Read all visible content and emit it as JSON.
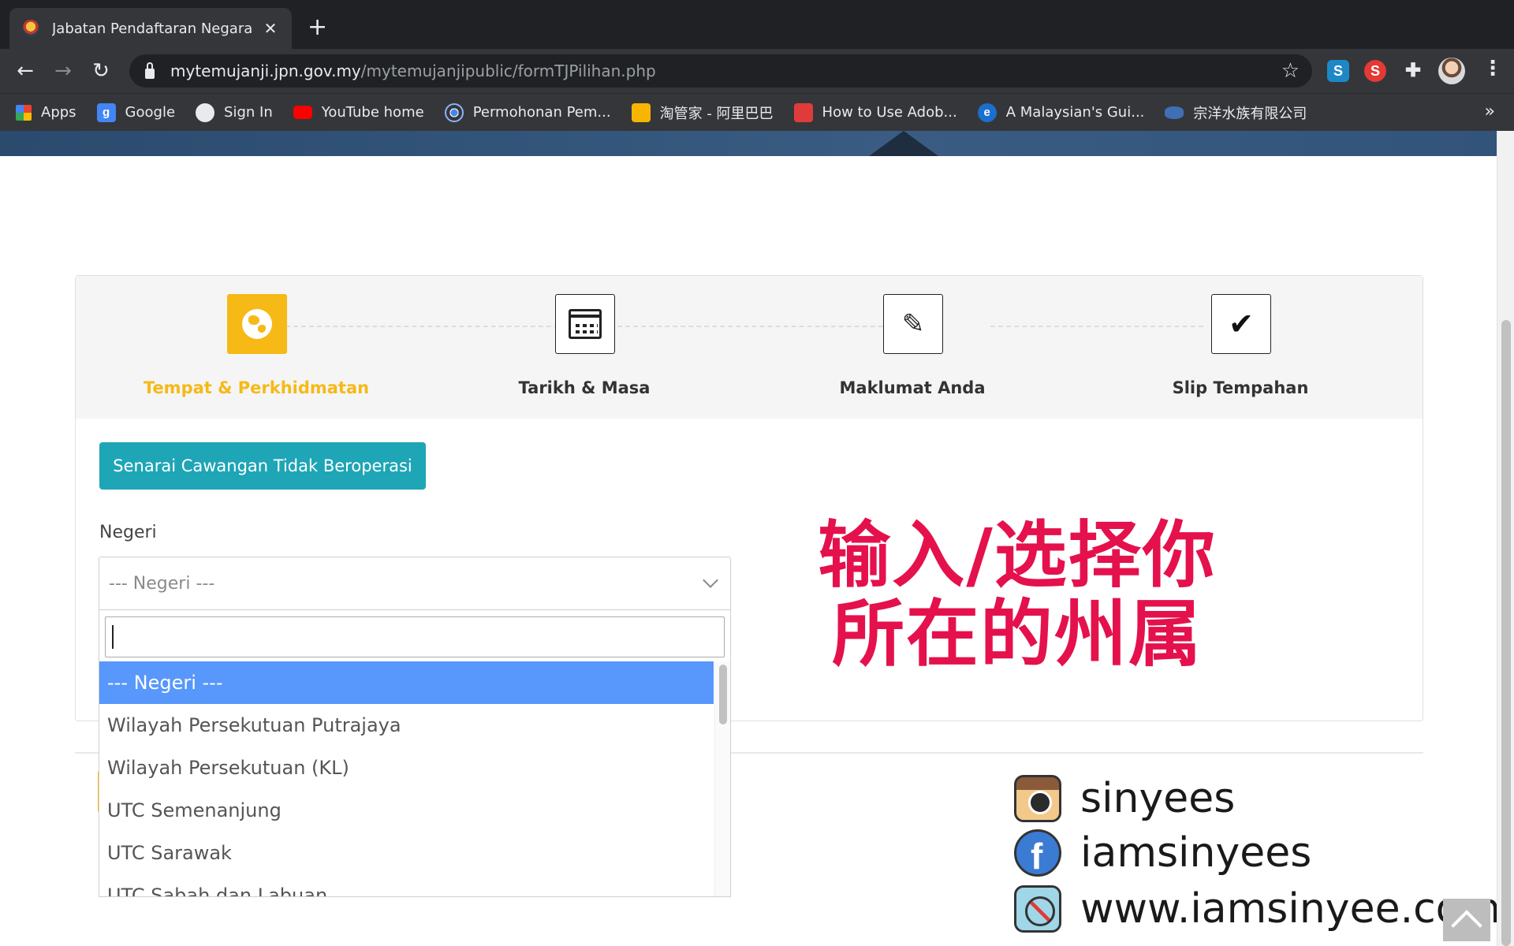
{
  "browser": {
    "tab_title": "Jabatan Pendaftaran Negara",
    "tab_close": "✕",
    "new_tab": "+",
    "url_host": "mytemujanji.jpn.gov.my",
    "url_path": "/mytemujanjipublic/formTJPilihan.php",
    "bookmarks": [
      {
        "label": "Apps",
        "icon": "apps-grid-icon"
      },
      {
        "label": "Google",
        "icon": "google-icon"
      },
      {
        "label": "Sign In",
        "icon": "globe-icon"
      },
      {
        "label": "YouTube home",
        "icon": "youtube-icon"
      },
      {
        "label": "Permohonan Pem...",
        "icon": "chrome-icon"
      },
      {
        "label": "淘管家 - 阿里巴巴",
        "icon": "taobao-icon"
      },
      {
        "label": "How to Use Adob...",
        "icon": "adobe-icon"
      },
      {
        "label": "A Malaysian's Gui...",
        "icon": "ie-icon"
      },
      {
        "label": "宗洋水族有限公司",
        "icon": "eye-icon"
      }
    ],
    "bookmarks_more": "»",
    "ext_s1": "S",
    "ext_s2": "S"
  },
  "steps": [
    {
      "label": "Tempat & Perkhidmatan",
      "icon": "globe-icon",
      "active": true
    },
    {
      "label": "Tarikh & Masa",
      "icon": "calendar-icon",
      "active": false
    },
    {
      "label": "Maklumat Anda",
      "icon": "pencil-icon",
      "active": false
    },
    {
      "label": "Slip Tempahan",
      "icon": "check-icon",
      "active": false
    }
  ],
  "form": {
    "branch_button": "Senarai Cawangan Tidak Beroperasi",
    "negeri_label": "Negeri",
    "negeri_placeholder": "--- Negeri ---",
    "search_value": "",
    "options": [
      "--- Negeri ---",
      "Wilayah Persekutuan Putrajaya",
      "Wilayah Persekutuan (KL)",
      "UTC Semenanjung",
      "UTC Sarawak",
      "UTC Sabah dan Labuan"
    ],
    "selected_index": 0
  },
  "overlay": {
    "line1": "输入/选择你",
    "line2": "所在的州属"
  },
  "social": [
    {
      "text": "sinyees",
      "icon": "instagram-icon"
    },
    {
      "text": "iamsinyees",
      "icon": "facebook-icon"
    },
    {
      "text": "www.iamsinyee.com",
      "icon": "safari-compass-icon"
    }
  ],
  "colors": {
    "active_step": "#f6b916",
    "teal_button": "#1ea5b6",
    "selected_option": "#5897fb",
    "overlay_text": "#e4114c"
  }
}
